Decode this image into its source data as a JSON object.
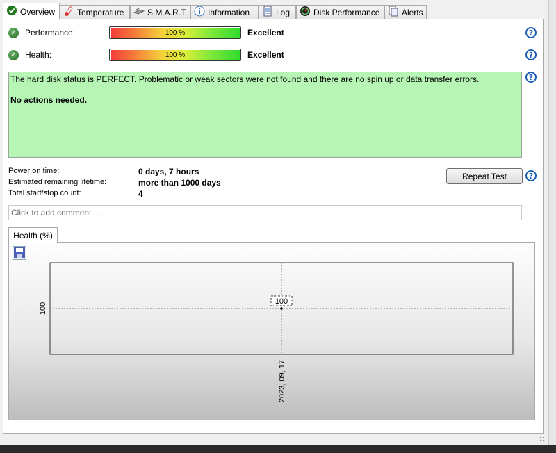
{
  "tabs": [
    {
      "label": "Overview",
      "icon": "check-circle-icon"
    },
    {
      "label": "Temperature",
      "icon": "thermometer-icon"
    },
    {
      "label": "S.M.A.R.T.",
      "icon": "smart-tools-icon"
    },
    {
      "label": "Information",
      "icon": "info-icon"
    },
    {
      "label": "Log",
      "icon": "log-document-icon"
    },
    {
      "label": "Disk Performance",
      "icon": "gauge-icon"
    },
    {
      "label": "Alerts",
      "icon": "alerts-document-icon"
    }
  ],
  "performance": {
    "label": "Performance:",
    "value": "100 %",
    "rating": "Excellent",
    "percent": 100
  },
  "health": {
    "label": "Health:",
    "value": "100 %",
    "rating": "Excellent",
    "percent": 100
  },
  "status": {
    "message": "The hard disk status is PERFECT. Problematic or weak sectors were not found and there are no spin up or data transfer errors.",
    "action": "No actions needed."
  },
  "info": [
    {
      "label": "Power on time:",
      "value": "0 days, 7 hours"
    },
    {
      "label": "Estimated remaining lifetime:",
      "value": "more than 1000 days"
    },
    {
      "label": "Total start/stop count:",
      "value": "4"
    }
  ],
  "repeat_button": "Repeat Test",
  "comment_placeholder": "Click to add comment ...",
  "chart_tab": "Health (%)",
  "chart_data": {
    "type": "line",
    "x": [
      "2023, 09, 17"
    ],
    "series": [
      {
        "values": [
          100
        ]
      }
    ],
    "data_labels": [
      "100"
    ],
    "ytick_labels": [
      "100"
    ],
    "xtick_labels": [
      "2023, 09, 17"
    ],
    "grid": true,
    "color": "#000000"
  }
}
